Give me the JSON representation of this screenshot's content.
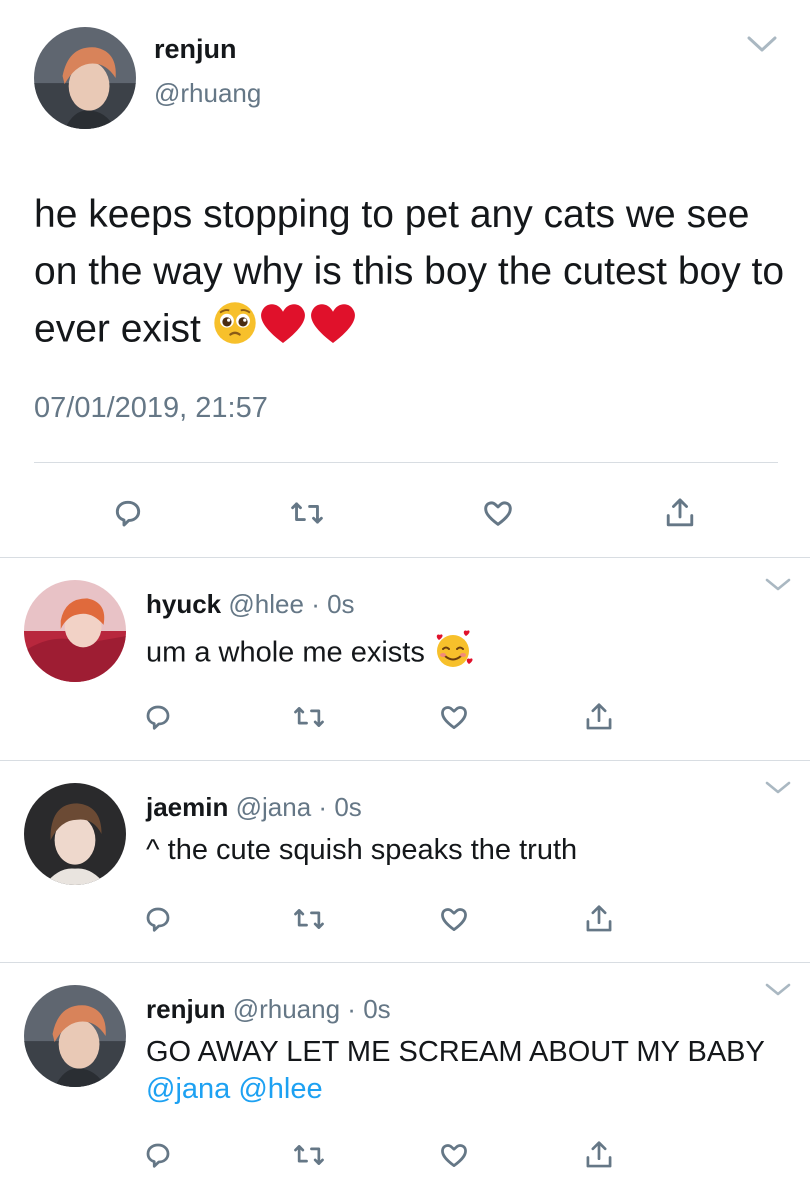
{
  "main_tweet": {
    "display_name": "renjun",
    "handle": "@rhuang",
    "text": "he keeps stopping to pet any cats we see on the way why is this boy the cutest boy to ever exist",
    "emojis": [
      "pleading-face-emoji",
      "red-heart-emoji",
      "red-heart-emoji"
    ],
    "timestamp": "07/01/2019, 21:57"
  },
  "replies": [
    {
      "display_name": "hyuck",
      "handle": "@hlee",
      "separator": "·",
      "time": "0s",
      "text": "um a whole me exists",
      "emoji": "smiling-face-with-hearts-emoji"
    },
    {
      "display_name": "jaemin",
      "handle": "@jana",
      "separator": "·",
      "time": "0s",
      "text": "^ the cute squish speaks the truth"
    },
    {
      "display_name": "renjun",
      "handle": "@rhuang",
      "separator": "·",
      "time": "0s",
      "text": "GO AWAY LET ME SCREAM ABOUT MY BABY",
      "mentions": [
        "@jana",
        "@hlee"
      ]
    }
  ],
  "colors": {
    "text": "#14171a",
    "secondary": "#657786",
    "link": "#1da1f2",
    "divider": "#d8dde2",
    "heart": "#e0112b",
    "emoji_yellow": "#f7c02b"
  },
  "icons": {
    "actions": [
      "reply-icon",
      "retweet-icon",
      "like-icon",
      "share-icon"
    ],
    "menu": "chevron-down-icon"
  }
}
